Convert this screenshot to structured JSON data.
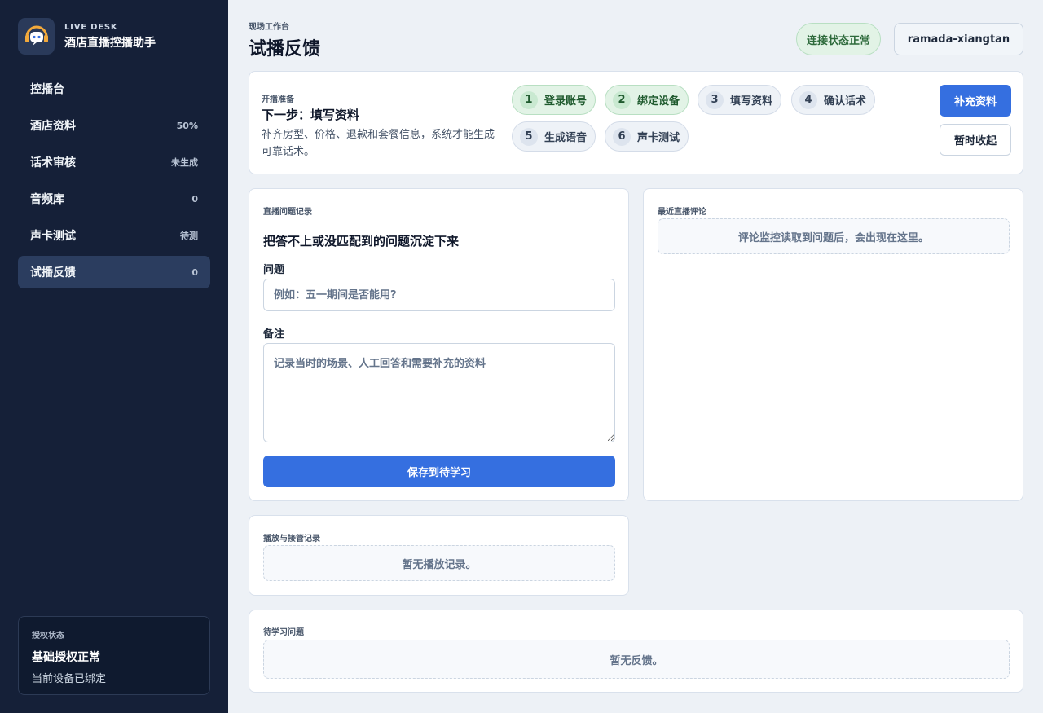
{
  "brand": {
    "eyebrow": "LIVE DESK",
    "title": "酒店直播控播助手",
    "logo_icon": "chat-bubble-icon"
  },
  "nav": [
    {
      "label": "控播台",
      "badge": ""
    },
    {
      "label": "酒店资料",
      "badge": "50%"
    },
    {
      "label": "话术审核",
      "badge": "未生成"
    },
    {
      "label": "音频库",
      "badge": "0"
    },
    {
      "label": "声卡测试",
      "badge": "待测"
    },
    {
      "label": "试播反馈",
      "badge": "0",
      "active": true
    }
  ],
  "license": {
    "label": "授权状态",
    "title": "基础授权正常",
    "subtitle": "当前设备已绑定"
  },
  "header": {
    "eyebrow": "现场工作台",
    "title": "试播反馈",
    "connection_status": "连接状态正常",
    "account": "ramada-xiangtan"
  },
  "prep": {
    "label": "开播准备",
    "next": "下一步：填写资料",
    "description": "补齐房型、价格、退款和套餐信息，系统才能生成可靠话术。",
    "steps": [
      {
        "num": "1",
        "label": "登录账号",
        "done": true
      },
      {
        "num": "2",
        "label": "绑定设备",
        "done": true
      },
      {
        "num": "3",
        "label": "填写资料",
        "done": false
      },
      {
        "num": "4",
        "label": "确认话术",
        "done": false
      },
      {
        "num": "5",
        "label": "生成语音",
        "done": false
      },
      {
        "num": "6",
        "label": "声卡测试",
        "done": false
      }
    ],
    "primary_btn": "补充资料",
    "secondary_btn": "暂时收起"
  },
  "issue": {
    "label": "直播问题记录",
    "heading": "把答不上或没匹配到的问题沉淀下来",
    "question_label": "问题",
    "question_placeholder": "例如：五一期间是否能用?",
    "note_label": "备注",
    "note_placeholder": "记录当时的场景、人工回答和需要补充的资料",
    "save_btn": "保存到待学习"
  },
  "comments": {
    "label": "最近直播评论",
    "empty": "评论监控读取到问题后，会出现在这里。"
  },
  "playlog": {
    "label": "播放与接管记录",
    "empty": "暂无播放记录。"
  },
  "learn": {
    "label": "待学习问题",
    "empty": "暂无反馈。"
  }
}
